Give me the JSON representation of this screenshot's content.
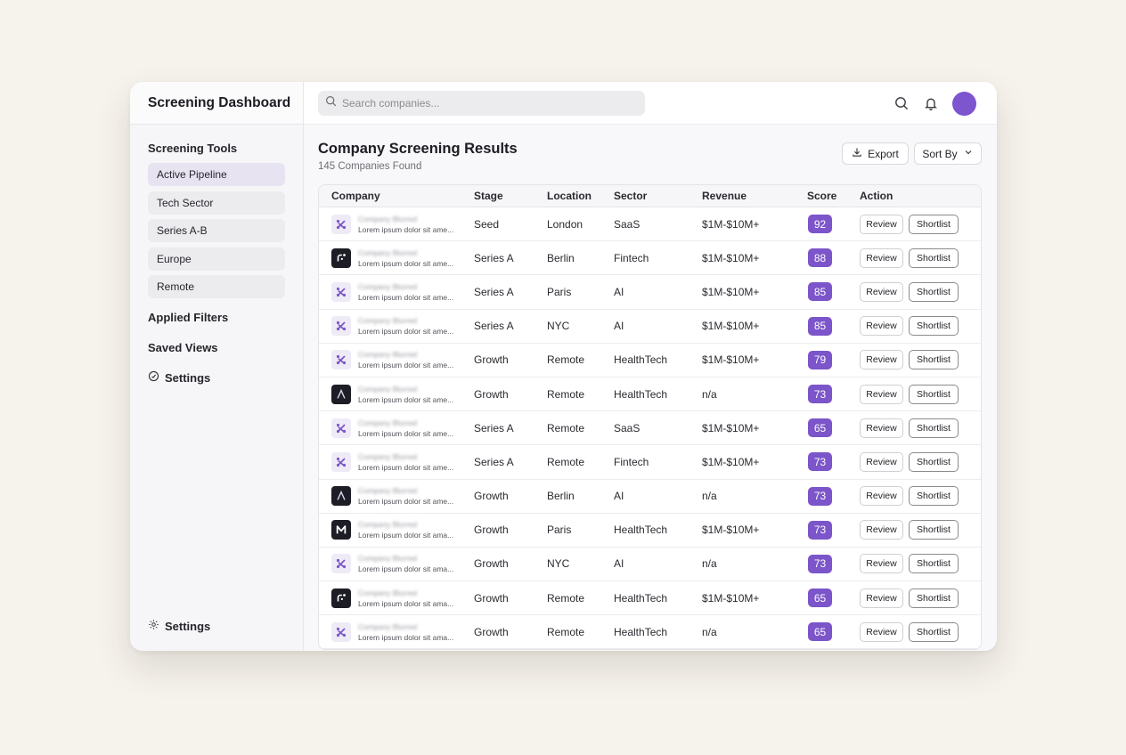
{
  "app": {
    "title": "Screening Dashboard"
  },
  "sidebar": {
    "tools_heading": "Screening Tools",
    "tools": [
      {
        "label": "Active Pipeline",
        "active": true
      },
      {
        "label": "Tech Sector",
        "active": false
      },
      {
        "label": "Series A-B",
        "active": false
      },
      {
        "label": "Europe",
        "active": false
      },
      {
        "label": "Remote",
        "active": false
      }
    ],
    "applied_filters": "Applied Filters",
    "saved_views": "Saved Views",
    "settings_label": "Settings",
    "bottom_settings_label": "Settings"
  },
  "topbar": {
    "search_placeholder": "Search companies...",
    "icons": [
      "search-icon",
      "bell-icon",
      "avatar"
    ],
    "avatar_color": "#7c55cf"
  },
  "main": {
    "title": "Company Screening Results",
    "subtitle": "145 Companies Found",
    "export_label": "Export",
    "sort_label": "Sort By"
  },
  "table": {
    "columns": [
      "Company",
      "Stage",
      "Location",
      "Sector",
      "Revenue",
      "Score",
      "Action"
    ],
    "review_label": "Review",
    "shortlist_label": "Shortlist",
    "rows": [
      {
        "logo": "light-k",
        "name": "Company Blurred",
        "desc": "Lorem ipsum dolor sit ame...",
        "stage": "Seed",
        "location": "London",
        "sector": "SaaS",
        "revenue": "$1M-$10M+",
        "score": "92"
      },
      {
        "logo": "dark-dots",
        "name": "Company Blurred",
        "desc": "Lorem ipsum dolor sit ame...",
        "stage": "Series A",
        "location": "Berlin",
        "sector": "Fintech",
        "revenue": "$1M-$10M+",
        "score": "88"
      },
      {
        "logo": "light-k",
        "name": "Company Blurred",
        "desc": "Lorem ipsum dolor sit ame...",
        "stage": "Series A",
        "location": "Paris",
        "sector": "AI",
        "revenue": "$1M-$10M+",
        "score": "85"
      },
      {
        "logo": "light-k",
        "name": "Company Blurred",
        "desc": "Lorem ipsum dolor sit ame...",
        "stage": "Series A",
        "location": "NYC",
        "sector": "AI",
        "revenue": "$1M-$10M+",
        "score": "85"
      },
      {
        "logo": "light-k",
        "name": "Company Blurred",
        "desc": "Lorem ipsum dolor sit ame...",
        "stage": "Growth",
        "location": "Remote",
        "sector": "HealthTech",
        "revenue": "$1M-$10M+",
        "score": "79"
      },
      {
        "logo": "dark-a",
        "name": "Company Blurred",
        "desc": "Lorem ipsum dolor sit ame...",
        "stage": "Growth",
        "location": "Remote",
        "sector": "HealthTech",
        "revenue": "n/a",
        "score": "73"
      },
      {
        "logo": "light-k",
        "name": "Company Blurred",
        "desc": "Lorem ipsum dolor sit ame...",
        "stage": "Series A",
        "location": "Remote",
        "sector": "SaaS",
        "revenue": "$1M-$10M+",
        "score": "65"
      },
      {
        "logo": "light-k",
        "name": "Company Blurred",
        "desc": "Lorem ipsum dolor sit ame...",
        "stage": "Series A",
        "location": "Remote",
        "sector": "Fintech",
        "revenue": "$1M-$10M+",
        "score": "73"
      },
      {
        "logo": "dark-a",
        "name": "Company Blurred",
        "desc": "Lorem ipsum dolor sit ame...",
        "stage": "Growth",
        "location": "Berlin",
        "sector": "AI",
        "revenue": "n/a",
        "score": "73"
      },
      {
        "logo": "dark-m",
        "name": "Company Blurred",
        "desc": "Lorem ipsum dolor sit ama...",
        "stage": "Growth",
        "location": "Paris",
        "sector": "HealthTech",
        "revenue": "$1M-$10M+",
        "score": "73"
      },
      {
        "logo": "light-k",
        "name": "Company Blurred",
        "desc": "Lorem ipsum dolor sit ama...",
        "stage": "Growth",
        "location": "NYC",
        "sector": "AI",
        "revenue": "n/a",
        "score": "73"
      },
      {
        "logo": "dark-dots",
        "name": "Company Blurred",
        "desc": "Lorem ipsum dolor sit ama...",
        "stage": "Growth",
        "location": "Remote",
        "sector": "HealthTech",
        "revenue": "$1M-$10M+",
        "score": "65"
      },
      {
        "logo": "light-k",
        "name": "Company Blurred",
        "desc": "Lorem ipsum dolor sit ama...",
        "stage": "Growth",
        "location": "Remote",
        "sector": "HealthTech",
        "revenue": "n/a",
        "score": "65"
      }
    ]
  },
  "colors": {
    "accent": "#7b55c9",
    "background": "#f6f2ec"
  }
}
